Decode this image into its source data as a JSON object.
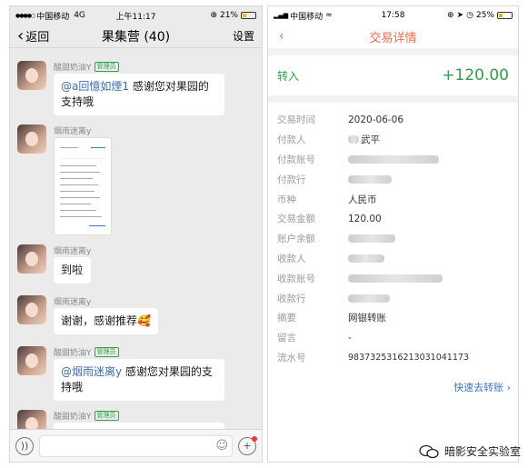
{
  "left": {
    "status": {
      "signal": "●●●●○",
      "carrier": "中国移动",
      "network": "4G",
      "time": "上午11:17",
      "battery": "21%"
    },
    "nav": {
      "back_label": "返回",
      "title": "果集营 (40)",
      "settings_label": "设置"
    },
    "messages": [
      {
        "sender": "酸甜奶油Y",
        "badge": "管理员",
        "mention": "@a回憶如煙1",
        "text": " 感谢您对果园的支持哦"
      },
      {
        "sender": "烟雨迷离y",
        "badge": "",
        "image": "transaction-screenshot"
      },
      {
        "sender": "烟雨迷离y",
        "badge": "",
        "text": "到啦"
      },
      {
        "sender": "烟雨迷离y",
        "badge": "",
        "text": "谢谢，感谢推荐🥰"
      },
      {
        "sender": "酸甜奶油Y",
        "badge": "管理员",
        "mention": "@烟雨迷离y",
        "text": " 感谢您对果园的支持哦"
      },
      {
        "sender": "酸甜奶油Y",
        "badge": "管理员"
      }
    ]
  },
  "right": {
    "status": {
      "carrier": "中国移动",
      "time": "17:58",
      "battery": "25%"
    },
    "nav": {
      "back_label": "‹",
      "title": "交易详情"
    },
    "transfer": {
      "label": "转入",
      "amount": "+120.00"
    },
    "details": [
      {
        "key": "交易时间",
        "value": "2020-06-06"
      },
      {
        "key": "付款人",
        "value": "武平"
      },
      {
        "key": "付款账号",
        "value": ""
      },
      {
        "key": "付款行",
        "value": ""
      },
      {
        "key": "币种",
        "value": "人民币"
      },
      {
        "key": "交易金额",
        "value": "120.00"
      },
      {
        "key": "账户余额",
        "value": ""
      },
      {
        "key": "收款人",
        "value": ""
      },
      {
        "key": "收款账号",
        "value": ""
      },
      {
        "key": "收款行",
        "value": ""
      },
      {
        "key": "摘要",
        "value": "网银转账"
      },
      {
        "key": "留言",
        "value": "-"
      },
      {
        "key": "流水号",
        "value": "983732531621303104117З"
      }
    ],
    "quick_transfer": "快速去转账 ›"
  },
  "watermark": "暗影安全实验室",
  "colors": {
    "wechat_green": "#2fa34a",
    "bank_orange": "#f06a48",
    "amount_green": "#2ba14a",
    "link_blue": "#3b76c7"
  }
}
